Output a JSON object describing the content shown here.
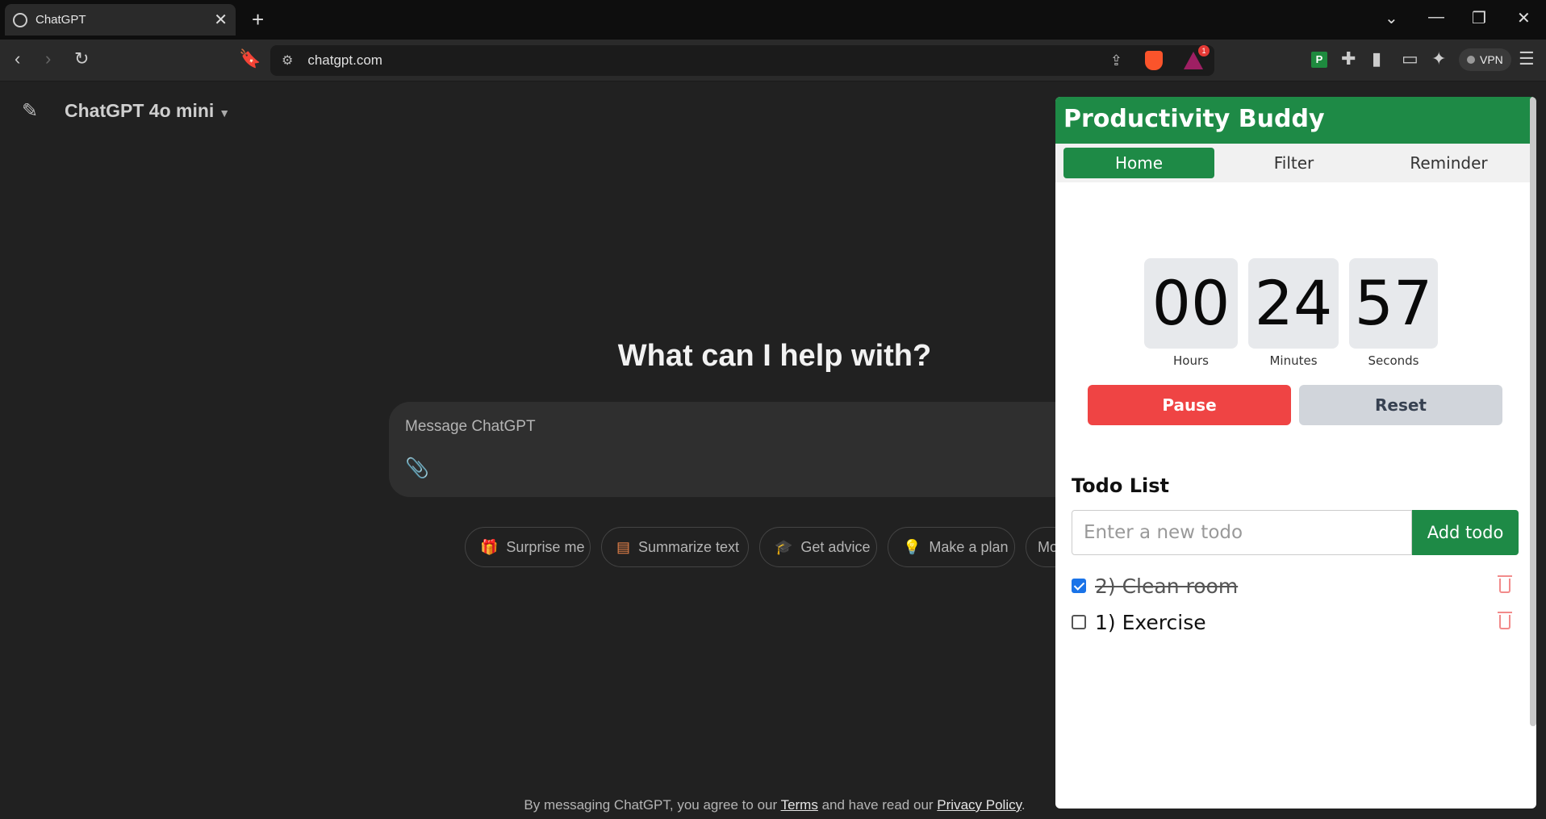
{
  "browser": {
    "tab_title": "ChatGPT",
    "tab_close": "✕",
    "new_tab": "+",
    "url": "chatgpt.com",
    "rewards_badge": "1",
    "vpn_label": "VPN",
    "ext_letter": "P"
  },
  "chatgpt": {
    "model_name": "ChatGPT 4o mini",
    "headline": "What can I help with?",
    "composer_placeholder": "Message ChatGPT",
    "chips": [
      {
        "label": "Surprise me",
        "icon": "🎁",
        "color": "#5ab8e8"
      },
      {
        "label": "Summarize text",
        "icon": "▤",
        "color": "#e8834a"
      },
      {
        "label": "Get advice",
        "icon": "🎓",
        "color": "#5ab8e8"
      },
      {
        "label": "Make a plan",
        "icon": "💡",
        "color": "#e2c541"
      },
      {
        "label": "Mo",
        "icon": "",
        "color": "#b4b4b4"
      }
    ],
    "footer": {
      "prefix": "By messaging ChatGPT, you agree to our ",
      "terms": "Terms",
      "middle": " and have read our ",
      "privacy": "Privacy Policy",
      "suffix": "."
    }
  },
  "popup": {
    "title": "Productivity Buddy",
    "tabs": [
      "Home",
      "Filter",
      "Reminder"
    ],
    "active_tab": "Home",
    "timer": {
      "hours": "00",
      "minutes": "24",
      "seconds": "57",
      "hours_label": "Hours",
      "minutes_label": "Minutes",
      "seconds_label": "Seconds"
    },
    "pause_label": "Pause",
    "reset_label": "Reset",
    "todo_heading": "Todo List",
    "todo_placeholder": "Enter a new todo",
    "add_todo_label": "Add todo",
    "todos": [
      {
        "text": "2) Clean room",
        "done": true
      },
      {
        "text": "1) Exercise",
        "done": false
      }
    ],
    "accent": "#1e8a46"
  }
}
